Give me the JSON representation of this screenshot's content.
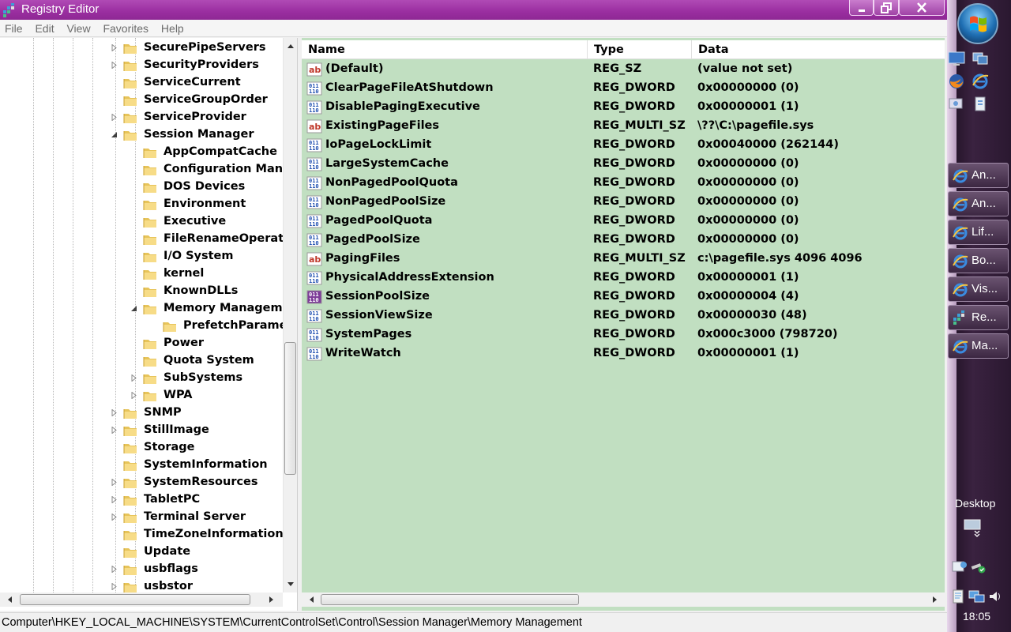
{
  "window": {
    "title": "Registry Editor",
    "menu": [
      "File",
      "Edit",
      "View",
      "Favorites",
      "Help"
    ]
  },
  "tree": {
    "items": [
      {
        "label": "SecurePipeServers",
        "level": 0,
        "expander": "collapsed"
      },
      {
        "label": "SecurityProviders",
        "level": 0,
        "expander": "collapsed"
      },
      {
        "label": "ServiceCurrent",
        "level": 0,
        "expander": "none"
      },
      {
        "label": "ServiceGroupOrder",
        "level": 0,
        "expander": "none"
      },
      {
        "label": "ServiceProvider",
        "level": 0,
        "expander": "collapsed"
      },
      {
        "label": "Session Manager",
        "level": 0,
        "expander": "expanded"
      },
      {
        "label": "AppCompatCache",
        "level": 1,
        "expander": "none"
      },
      {
        "label": "Configuration Manag",
        "level": 1,
        "expander": "none"
      },
      {
        "label": "DOS Devices",
        "level": 1,
        "expander": "none"
      },
      {
        "label": "Environment",
        "level": 1,
        "expander": "none"
      },
      {
        "label": "Executive",
        "level": 1,
        "expander": "none"
      },
      {
        "label": "FileRenameOperation",
        "level": 1,
        "expander": "none"
      },
      {
        "label": "I/O System",
        "level": 1,
        "expander": "none"
      },
      {
        "label": "kernel",
        "level": 1,
        "expander": "none"
      },
      {
        "label": "KnownDLLs",
        "level": 1,
        "expander": "none"
      },
      {
        "label": "Memory Managemen",
        "level": 1,
        "expander": "expanded"
      },
      {
        "label": "PrefetchParamete",
        "level": 2,
        "expander": "none"
      },
      {
        "label": "Power",
        "level": 1,
        "expander": "none"
      },
      {
        "label": "Quota System",
        "level": 1,
        "expander": "none"
      },
      {
        "label": "SubSystems",
        "level": 1,
        "expander": "collapsed"
      },
      {
        "label": "WPA",
        "level": 1,
        "expander": "collapsed"
      },
      {
        "label": "SNMP",
        "level": 0,
        "expander": "collapsed"
      },
      {
        "label": "StillImage",
        "level": 0,
        "expander": "collapsed"
      },
      {
        "label": "Storage",
        "level": 0,
        "expander": "none"
      },
      {
        "label": "SystemInformation",
        "level": 0,
        "expander": "none"
      },
      {
        "label": "SystemResources",
        "level": 0,
        "expander": "collapsed"
      },
      {
        "label": "TabletPC",
        "level": 0,
        "expander": "collapsed"
      },
      {
        "label": "Terminal Server",
        "level": 0,
        "expander": "collapsed"
      },
      {
        "label": "TimeZoneInformation",
        "level": 0,
        "expander": "none"
      },
      {
        "label": "Update",
        "level": 0,
        "expander": "none"
      },
      {
        "label": "usbflags",
        "level": 0,
        "expander": "collapsed"
      },
      {
        "label": "usbstor",
        "level": 0,
        "expander": "collapsed"
      }
    ]
  },
  "list": {
    "columns": [
      "Name",
      "Type",
      "Data"
    ],
    "rows": [
      {
        "name": "(Default)",
        "type": "REG_SZ",
        "data": "(value not set)",
        "icon": "string-value-icon"
      },
      {
        "name": "ClearPageFileAtShutdown",
        "type": "REG_DWORD",
        "data": "0x00000000 (0)",
        "icon": "binary-value-icon"
      },
      {
        "name": "DisablePagingExecutive",
        "type": "REG_DWORD",
        "data": "0x00000001 (1)",
        "icon": "binary-value-icon"
      },
      {
        "name": "ExistingPageFiles",
        "type": "REG_MULTI_SZ",
        "data": "\\??\\C:\\pagefile.sys",
        "icon": "string-value-icon"
      },
      {
        "name": "IoPageLockLimit",
        "type": "REG_DWORD",
        "data": "0x00040000 (262144)",
        "icon": "binary-value-icon"
      },
      {
        "name": "LargeSystemCache",
        "type": "REG_DWORD",
        "data": "0x00000000 (0)",
        "icon": "binary-value-icon"
      },
      {
        "name": "NonPagedPoolQuota",
        "type": "REG_DWORD",
        "data": "0x00000000 (0)",
        "icon": "binary-value-icon"
      },
      {
        "name": "NonPagedPoolSize",
        "type": "REG_DWORD",
        "data": "0x00000000 (0)",
        "icon": "binary-value-icon"
      },
      {
        "name": "PagedPoolQuota",
        "type": "REG_DWORD",
        "data": "0x00000000 (0)",
        "icon": "binary-value-icon"
      },
      {
        "name": "PagedPoolSize",
        "type": "REG_DWORD",
        "data": "0x00000000 (0)",
        "icon": "binary-value-icon"
      },
      {
        "name": "PagingFiles",
        "type": "REG_MULTI_SZ",
        "data": "c:\\pagefile.sys 4096 4096",
        "icon": "string-value-icon"
      },
      {
        "name": "PhysicalAddressExtension",
        "type": "REG_DWORD",
        "data": "0x00000001 (1)",
        "icon": "binary-value-icon"
      },
      {
        "name": "SessionPoolSize",
        "type": "REG_DWORD",
        "data": "0x00000004 (4)",
        "icon": "binary-value-icon",
        "highlight": true
      },
      {
        "name": "SessionViewSize",
        "type": "REG_DWORD",
        "data": "0x00000030 (48)",
        "icon": "binary-value-icon"
      },
      {
        "name": "SystemPages",
        "type": "REG_DWORD",
        "data": "0x000c3000 (798720)",
        "icon": "binary-value-icon"
      },
      {
        "name": "WriteWatch",
        "type": "REG_DWORD",
        "data": "0x00000001 (1)",
        "icon": "binary-value-icon"
      }
    ]
  },
  "statusbar": {
    "path": "Computer\\HKEY_LOCAL_MACHINE\\SYSTEM\\CurrentControlSet\\Control\\Session Manager\\Memory Management"
  },
  "taskbar": {
    "buttons": [
      {
        "label": "An...",
        "icon": "ie-icon"
      },
      {
        "label": "An...",
        "icon": "ie-icon"
      },
      {
        "label": "Lif...",
        "icon": "ie-icon"
      },
      {
        "label": "Bo...",
        "icon": "ie-icon"
      },
      {
        "label": "Vis...",
        "icon": "ie-icon"
      },
      {
        "label": "Re...",
        "icon": "regedit-icon"
      },
      {
        "label": "Ma...",
        "icon": "ie-icon"
      }
    ],
    "desktop_label": "Desktop",
    "clock": "18:05"
  },
  "colors": {
    "titlebar": "#9a2ea0",
    "list_background": "#c1dfc1",
    "taskbar": "#2a1830"
  }
}
